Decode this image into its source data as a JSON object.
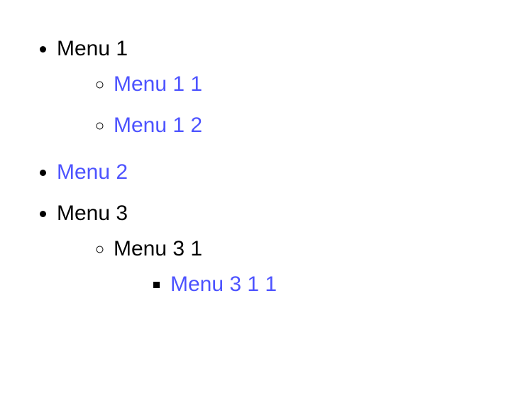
{
  "menu": {
    "items": [
      {
        "label": "Menu 1",
        "is_link": false,
        "children": [
          {
            "label": "Menu 1 1",
            "is_link": true
          },
          {
            "label": "Menu 1 2",
            "is_link": true
          }
        ]
      },
      {
        "label": "Menu 2",
        "is_link": true
      },
      {
        "label": "Menu 3",
        "is_link": false,
        "children": [
          {
            "label": "Menu 3 1",
            "is_link": false,
            "children": [
              {
                "label": "Menu 3 1 1",
                "is_link": true
              }
            ]
          }
        ]
      }
    ]
  },
  "colors": {
    "link": "#4d53ff",
    "text": "#000000"
  }
}
